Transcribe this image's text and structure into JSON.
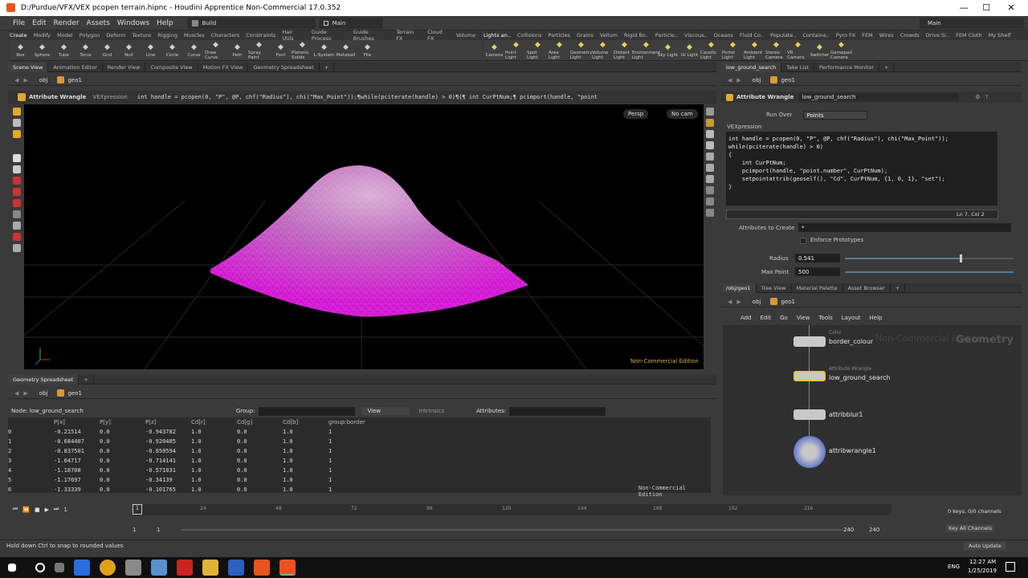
{
  "window": {
    "title": "D:/Purdue/VFX/VEX pcopen terrain.hipnc - Houdini Apprentice Non-Commercial 17.0.352"
  },
  "menubar": {
    "items": [
      "File",
      "Edit",
      "Render",
      "Assets",
      "Windows",
      "Help"
    ],
    "desktop": "Build",
    "layout": "Main",
    "right_layout": "Main"
  },
  "shelf_left": {
    "tabs": [
      "Create",
      "Modify",
      "Model",
      "Polygon",
      "Deform",
      "Texture",
      "Rigging",
      "Muscles",
      "Characters",
      "Constraints",
      "Hair Utils",
      "Guide Process",
      "Guide Brushes",
      "Terrain FX",
      "Cloud FX",
      "Volume"
    ],
    "tools": [
      {
        "label": "Box",
        "icon": "box-icon"
      },
      {
        "label": "Sphere",
        "icon": "sphere-icon"
      },
      {
        "label": "Tube",
        "icon": "tube-icon"
      },
      {
        "label": "Torus",
        "icon": "torus-icon"
      },
      {
        "label": "Grid",
        "icon": "grid-icon"
      },
      {
        "label": "Null",
        "icon": "null-icon"
      },
      {
        "label": "Line",
        "icon": "line-icon"
      },
      {
        "label": "Circle",
        "icon": "circle-icon"
      },
      {
        "label": "Curve",
        "icon": "curve-icon"
      },
      {
        "label": "Draw Curve",
        "icon": "draw-curve-icon"
      },
      {
        "label": "Path",
        "icon": "path-icon"
      },
      {
        "label": "Spray Paint",
        "icon": "spray-paint-icon"
      },
      {
        "label": "Font",
        "icon": "font-icon"
      },
      {
        "label": "Platonic Solids",
        "icon": "platonic-icon"
      },
      {
        "label": "L-System",
        "icon": "lsystem-icon"
      },
      {
        "label": "Metaball",
        "icon": "metaball-icon"
      },
      {
        "label": "File",
        "icon": "file-icon"
      }
    ]
  },
  "shelf_right": {
    "tabs": [
      "Lights an..",
      "Collisions",
      "Particles",
      "Grains",
      "Vellum",
      "Rigid Bo..",
      "Particle..",
      "Viscous..",
      "Oceans",
      "Fluid Co..",
      "Populate..",
      "Containe..",
      "Pyro FX",
      "FEM",
      "Wires",
      "Crowds",
      "Drive Si..",
      "FEM Cloth",
      "My Shelf"
    ],
    "tools": [
      {
        "label": "Camera",
        "icon": "camera-icon"
      },
      {
        "label": "Point Light",
        "icon": "point-light-icon"
      },
      {
        "label": "Spot Light",
        "icon": "spot-light-icon"
      },
      {
        "label": "Area Light",
        "icon": "area-light-icon"
      },
      {
        "label": "Geometry Light",
        "icon": "geometry-light-icon"
      },
      {
        "label": "Volume Light",
        "icon": "volume-light-icon"
      },
      {
        "label": "Distant Light",
        "icon": "distant-light-icon"
      },
      {
        "label": "Environment Light",
        "icon": "environment-light-icon"
      },
      {
        "label": "Sky Light",
        "icon": "sky-light-icon"
      },
      {
        "label": "GI Light",
        "icon": "gi-light-icon"
      },
      {
        "label": "Caustic Light",
        "icon": "caustic-light-icon"
      },
      {
        "label": "Portal Light",
        "icon": "portal-light-icon"
      },
      {
        "label": "Ambient Light",
        "icon": "ambient-light-icon"
      },
      {
        "label": "Stereo Camera",
        "icon": "stereo-camera-icon"
      },
      {
        "label": "VR Camera",
        "icon": "vr-camera-icon"
      },
      {
        "label": "Switcher",
        "icon": "switcher-icon"
      },
      {
        "label": "Gamepad Camera",
        "icon": "gamepad-camera-icon"
      }
    ]
  },
  "viewer": {
    "tabs": [
      "Scene View",
      "Animation Editor",
      "Render View",
      "Composite View",
      "Motion FX View",
      "Geometry Spreadsheet"
    ],
    "path_obj": "obj",
    "path_geo": "geo1",
    "node_type": "Attribute Wrangle",
    "node_subtype": "VEXpression",
    "snippet_preview": "int handle = pcopen(0, \"P\", @P, chf(\"Radius\"), chi(\"Max_Point\"));¶while(pciterate(handle) > 0)¶{¶    int CurPtNum;¶    pcimport(handle, \"point",
    "persp": "Persp",
    "cam": "No cam",
    "watermark": "Non-Commercial Edition"
  },
  "params": {
    "tabs": [
      "low_ground_search",
      "Take List",
      "Performance Monitor"
    ],
    "path_obj": "obj",
    "path_geo": "geo1",
    "node_type": "Attribute Wrangle",
    "node_name": "low_ground_search",
    "run_over_label": "Run Over",
    "run_over_value": "Points",
    "vex_label": "VEXpression",
    "code": [
      "int handle = pcopen(0, \"P\", @P, chf(\"Radius\"), chi(\"Max_Point\"));",
      "while(pciterate(handle) > 0)",
      "{",
      "    int CurPtNum;",
      "    pcimport(handle, \"point.number\", CurPtNum);",
      "    setpointattrib(geoself(), \"Cd\", CurPtNum, {1, 0, 1}, \"set\");",
      "}"
    ],
    "cursor_pos": "Ln 7, Col 2",
    "attr_create_label": "Attributes to Create",
    "attr_create_value": "*",
    "enforce_label": "Enforce Prototypes",
    "radius_label": "Radius",
    "radius_value": "0.541",
    "radius_fraction": 0.68,
    "maxpoint_label": "Max Point",
    "maxpoint_value": "500",
    "maxpoint_fraction": 1.0
  },
  "network": {
    "tabs": [
      "/obj/geo1",
      "Tree View",
      "Material Palette",
      "Asset Browser"
    ],
    "path_obj": "obj",
    "path_geo": "geo1",
    "menus": [
      "Add",
      "Edit",
      "Go",
      "View",
      "Tools",
      "Layout",
      "Help"
    ],
    "watermark": "Non-Commercial Edition",
    "context": "Geometry",
    "nodes": [
      {
        "name": "border_colour",
        "type": "Color"
      },
      {
        "name": "low_ground_search",
        "type": "Attribute Wrangle"
      },
      {
        "name": "attribblur1",
        "type": ""
      },
      {
        "name": "attribwrangle1",
        "type": ""
      }
    ]
  },
  "spreadsheet": {
    "tab": "Geometry Spreadsheet",
    "path_obj": "obj",
    "path_geo": "geo1",
    "node_label": "Node: low_ground_search",
    "group_label": "Group:",
    "view_label": "View",
    "intrinsics_label": "Intrinsics",
    "attributes_label": "Attributes:",
    "watermark": "Non-Commercial Edition",
    "columns": [
      "",
      "P[x]",
      "P[y]",
      "P[z]",
      "Cd[r]",
      "Cd[g]",
      "Cd[b]",
      "group:border"
    ],
    "rows": [
      [
        "0",
        "-0.21514",
        "0.0",
        "-0.943782",
        "1.0",
        "0.0",
        "1.0",
        "1"
      ],
      [
        "1",
        "-0.684407",
        "0.0",
        "-0.920485",
        "1.0",
        "0.0",
        "1.0",
        "1"
      ],
      [
        "2",
        "-0.837501",
        "0.0",
        "-0.850594",
        "1.0",
        "0.0",
        "1.0",
        "1"
      ],
      [
        "3",
        "-1.04717",
        "0.0",
        "-0.714141",
        "1.0",
        "0.0",
        "1.0",
        "1"
      ],
      [
        "4",
        "-1.18708",
        "0.0",
        "-0.571031",
        "1.0",
        "0.0",
        "1.0",
        "1"
      ],
      [
        "5",
        "-1.17697",
        "0.0",
        "-0.34139",
        "1.0",
        "0.0",
        "1.0",
        "1"
      ],
      [
        "6",
        "-1.33339",
        "0.0",
        "-0.101765",
        "1.0",
        "0.0",
        "1.0",
        "1"
      ]
    ]
  },
  "timeline": {
    "frame": "1",
    "ticks": [
      "24",
      "48",
      "72",
      "96",
      "120",
      "144",
      "168",
      "192",
      "216"
    ],
    "start": "1",
    "start2": "1",
    "end": "240",
    "end2": "240",
    "keys": "0 keys, 0/0 channels",
    "key_all": "Key All Channels",
    "auto_update": "Auto Update"
  },
  "status": {
    "message": "Hold down Ctrl to snap to rounded values"
  },
  "taskbar": {
    "lang": "ENG",
    "time": "12:27 AM",
    "date": "1/25/2019"
  }
}
